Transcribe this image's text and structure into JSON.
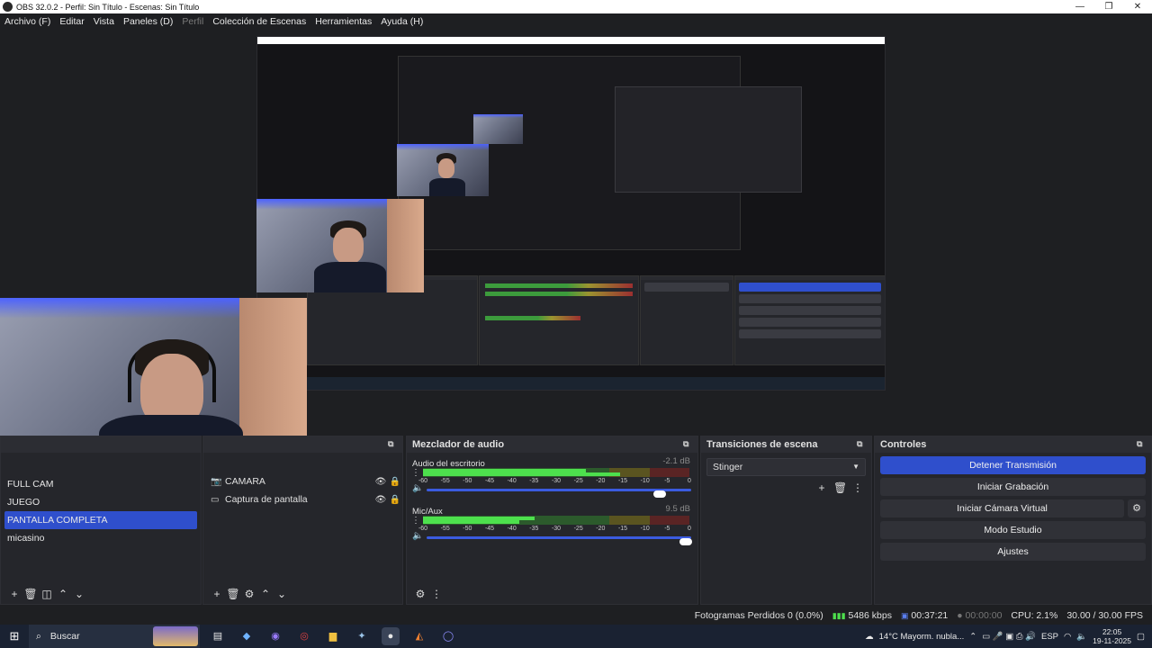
{
  "window": {
    "title": "OBS 32.0.2 - Perfil: Sin Título - Escenas: Sin Título"
  },
  "menu": [
    {
      "label": "Archivo (F)",
      "enabled": true
    },
    {
      "label": "Editar",
      "enabled": true
    },
    {
      "label": "Vista",
      "enabled": true
    },
    {
      "label": "Paneles (D)",
      "enabled": true
    },
    {
      "label": "Perfil",
      "enabled": false
    },
    {
      "label": "Colección de Escenas",
      "enabled": true
    },
    {
      "label": "Herramientas",
      "enabled": true
    },
    {
      "label": "Ayuda (H)",
      "enabled": true
    }
  ],
  "scenes": {
    "items": [
      "FULL CAM",
      "JUEGO",
      "PANTALLA COMPLETA",
      "micasino"
    ],
    "selected_index": 2
  },
  "sources": {
    "items": [
      {
        "label": "CAMARA",
        "icon": "camera-icon"
      },
      {
        "label": "Captura de pantalla",
        "icon": "monitor-icon"
      }
    ]
  },
  "mixer": {
    "title": "Mezclador de audio",
    "channels": [
      {
        "name": "Audio del escritorio",
        "db": "-2.1 dB",
        "level": 0.61,
        "level2": 0.74,
        "volume": 0.88
      },
      {
        "name": "Mic/Aux",
        "db": "9.5 dB",
        "level": 0.42,
        "level2": 0.36,
        "volume": 0.98
      }
    ],
    "ticks": [
      "-60",
      "-55",
      "-50",
      "-45",
      "-40",
      "-35",
      "-30",
      "-25",
      "-20",
      "-15",
      "-10",
      "-5",
      "0"
    ]
  },
  "transitions": {
    "title": "Transiciones de escena",
    "selected": "Stinger"
  },
  "controls": {
    "title": "Controles",
    "stop_stream": "Detener Transmisión",
    "start_recording": "Iniciar Grabación",
    "start_virtual_cam": "Iniciar Cámara Virtual",
    "studio_mode": "Modo Estudio",
    "settings": "Ajustes"
  },
  "status": {
    "dropped_frames": "Fotogramas Perdidos 0 (0.0%)",
    "bitrate": "5486 kbps",
    "stream_time": "00:37:21",
    "rec_time": "00:00:00",
    "cpu": "CPU: 2.1%",
    "fps": "30.00 / 30.00 FPS"
  },
  "taskbar": {
    "search_placeholder": "Buscar",
    "weather": "14°C  Mayorm. nubla...",
    "lang": "ESP",
    "time": "22:05",
    "date": "19-11-2025"
  },
  "colors": {
    "accent": "#2f4fcc",
    "meter_green": "#4de04d",
    "panel_bg": "#25262b",
    "window_bg": "#1e1f22"
  }
}
